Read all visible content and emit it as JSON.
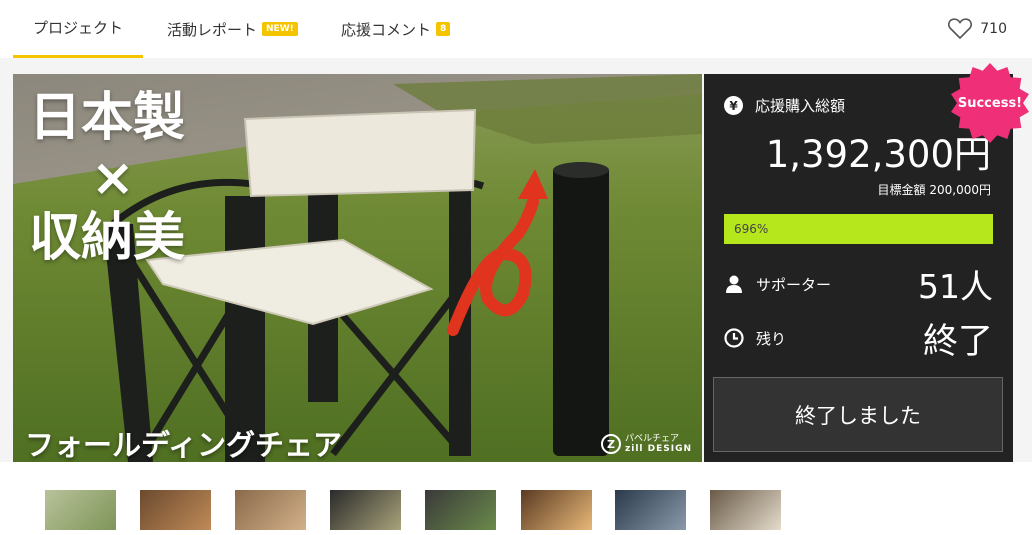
{
  "tabs": [
    {
      "label": "プロジェクト",
      "badge": ""
    },
    {
      "label": "活動レポート",
      "badge": "NEW!"
    },
    {
      "label": "応援コメント",
      "badge": "8"
    }
  ],
  "likes": "710",
  "hero": {
    "title_line1": "日本製",
    "title_line2": "×",
    "title_line3": "収納美",
    "caption": "フォールディングチェア",
    "brand_mark": "Z",
    "brand_line1": "パベルチェア",
    "brand_line2": "zill DESIGN"
  },
  "stats": {
    "yen_symbol": "¥",
    "total_label": "応援購入総額",
    "total_amount": "1,392,300円",
    "goal_label": "目標金額 200,000円",
    "progress_text": "696%",
    "progress_fraction": 1.0,
    "supporters_label": "サポーター",
    "supporters_value": "51人",
    "remaining_label": "残り",
    "remaining_value": "終了",
    "ended_button": "終了しました",
    "success_badge": "Success!"
  },
  "colors": {
    "accent": "#f5c400",
    "progress": "#b6e61c",
    "panel": "#222222",
    "success": "#ef2f78"
  },
  "thumbnails": [
    {
      "name": "thumbnail-1"
    },
    {
      "name": "thumbnail-2"
    },
    {
      "name": "thumbnail-3"
    },
    {
      "name": "thumbnail-4"
    },
    {
      "name": "thumbnail-5"
    },
    {
      "name": "thumbnail-6"
    },
    {
      "name": "thumbnail-7"
    },
    {
      "name": "thumbnail-8"
    }
  ]
}
